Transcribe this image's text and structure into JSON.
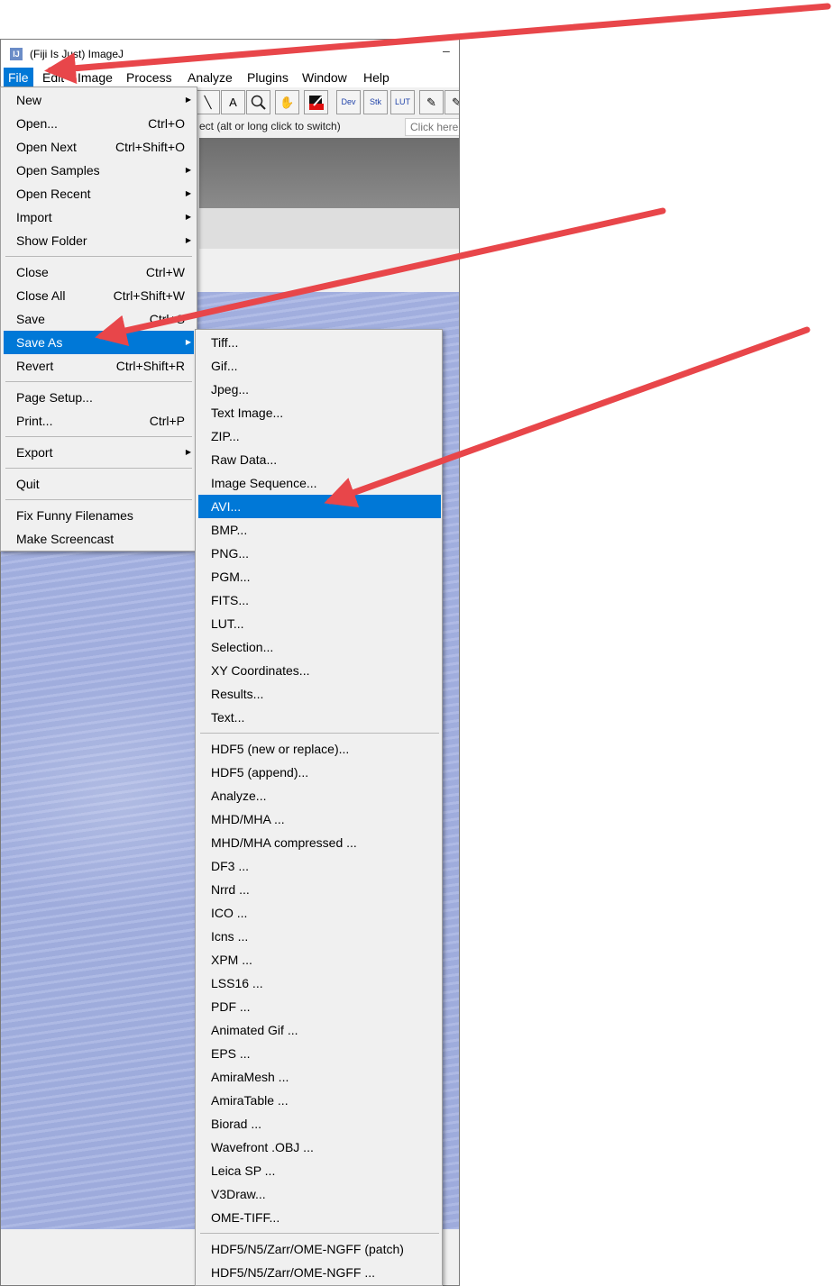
{
  "window": {
    "title": "(Fiji Is Just) ImageJ",
    "logo": "fiji-logo",
    "minimize_glyph": "–"
  },
  "menubar": [
    "File",
    "Edit",
    "Image",
    "Process",
    "Analyze",
    "Plugins",
    "Window",
    "Help"
  ],
  "toolbar": {
    "tools": [
      "line-tool",
      "text-tool",
      "magnifier-tool",
      "hand-tool",
      "color-picker-tool"
    ],
    "text_tool_glyph": "A",
    "dev": "Dev",
    "stk": "Stk",
    "lut": "LUT"
  },
  "status": {
    "text": "ect (alt or long click to switch)",
    "search_placeholder": "Click here to search"
  },
  "file_menu": {
    "items": [
      {
        "label": "New",
        "shortcut": "",
        "submenu": true
      },
      {
        "label": "Open...",
        "shortcut": "Ctrl+O"
      },
      {
        "label": "Open Next",
        "shortcut": "Ctrl+Shift+O"
      },
      {
        "label": "Open Samples",
        "shortcut": "",
        "submenu": true
      },
      {
        "label": "Open Recent",
        "shortcut": "",
        "submenu": true
      },
      {
        "label": "Import",
        "shortcut": "",
        "submenu": true
      },
      {
        "label": "Show Folder",
        "shortcut": "",
        "submenu": true
      },
      {
        "label": "Close",
        "shortcut": "Ctrl+W"
      },
      {
        "label": "Close All",
        "shortcut": "Ctrl+Shift+W"
      },
      {
        "label": "Save",
        "shortcut": "Ctrl+S"
      },
      {
        "label": "Save As",
        "shortcut": "",
        "submenu": true,
        "highlighted": true
      },
      {
        "label": "Revert",
        "shortcut": "Ctrl+Shift+R"
      },
      {
        "label": "Page Setup...",
        "shortcut": ""
      },
      {
        "label": "Print...",
        "shortcut": "Ctrl+P"
      },
      {
        "label": "Export",
        "shortcut": "",
        "submenu": true
      },
      {
        "label": "Quit",
        "shortcut": ""
      },
      {
        "label": "Fix Funny Filenames",
        "shortcut": ""
      },
      {
        "label": "Make Screencast",
        "shortcut": ""
      }
    ]
  },
  "saveas_menu": {
    "items": [
      "Tiff...",
      "Gif...",
      "Jpeg...",
      "Text Image...",
      "ZIP...",
      "Raw Data...",
      "Image Sequence...",
      "AVI...",
      "BMP...",
      "PNG...",
      "PGM...",
      "FITS...",
      "LUT...",
      "Selection...",
      "XY Coordinates...",
      "Results...",
      "Text...",
      "HDF5 (new or replace)...",
      "HDF5 (append)...",
      "Analyze...",
      "MHD/MHA ...",
      "MHD/MHA compressed ...",
      "DF3 ...",
      "Nrrd ...",
      "ICO ...",
      "Icns ...",
      "XPM ...",
      "LSS16 ...",
      "PDF ...",
      "Animated Gif ...",
      "EPS ...",
      "AmiraMesh ...",
      "AmiraTable ...",
      "Biorad ...",
      "Wavefront .OBJ ...",
      "Leica SP ...",
      "V3Draw...",
      "OME-TIFF...",
      "HDF5/N5/Zarr/OME-NGFF (patch)",
      "HDF5/N5/Zarr/OME-NGFF ..."
    ],
    "highlighted": "AVI..."
  },
  "annotation_color": "#e8464a"
}
